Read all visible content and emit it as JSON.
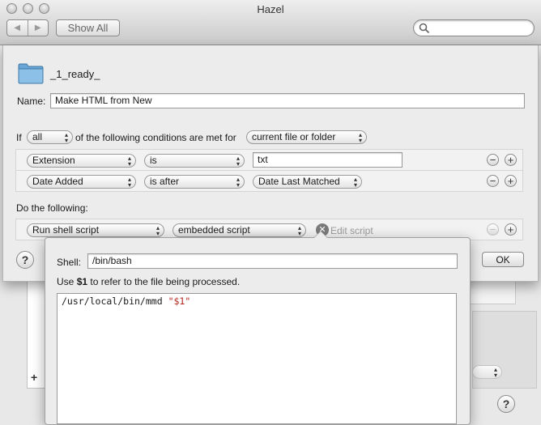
{
  "window": {
    "title": "Hazel",
    "back_glyph": "◀",
    "forward_glyph": "▶",
    "show_all_label": "Show All",
    "search_placeholder": ""
  },
  "sheet": {
    "folder_name": "_1_ready_",
    "name_label": "Name:",
    "name_value": "Make HTML from New",
    "conditions": {
      "prefix": "If",
      "match": "all",
      "middle": "of the following conditions are met for",
      "target": "current file or folder"
    },
    "rules": [
      {
        "attribute": "Extension",
        "operator": "is",
        "value": "txt",
        "value_is_field": true
      },
      {
        "attribute": "Date Added",
        "operator": "is after",
        "value": "Date Last Matched",
        "value_is_field": false
      }
    ],
    "actions_label": "Do the following:",
    "action": {
      "type": "Run shell script",
      "source": "embedded script",
      "edit_label": "Edit script"
    },
    "ok_label": "OK",
    "help_glyph": "?",
    "add_glyph": "+",
    "remove_glyph": "−"
  },
  "popover": {
    "shell_label": "Shell:",
    "shell_value": "/bin/bash",
    "hint_prefix": "Use ",
    "hint_var": "$1",
    "hint_suffix": " to refer to the file being processed.",
    "script_command": "/usr/local/bin/mmd ",
    "script_arg": "\"$1\""
  },
  "background": {
    "list_add_glyph": "+",
    "help_glyph": "?"
  },
  "colors": {
    "window_bg": "#e8e8e8",
    "sheet_bg": "#ececec",
    "folder_blue": "#6aa7d6",
    "script_string": "#b3261e"
  }
}
